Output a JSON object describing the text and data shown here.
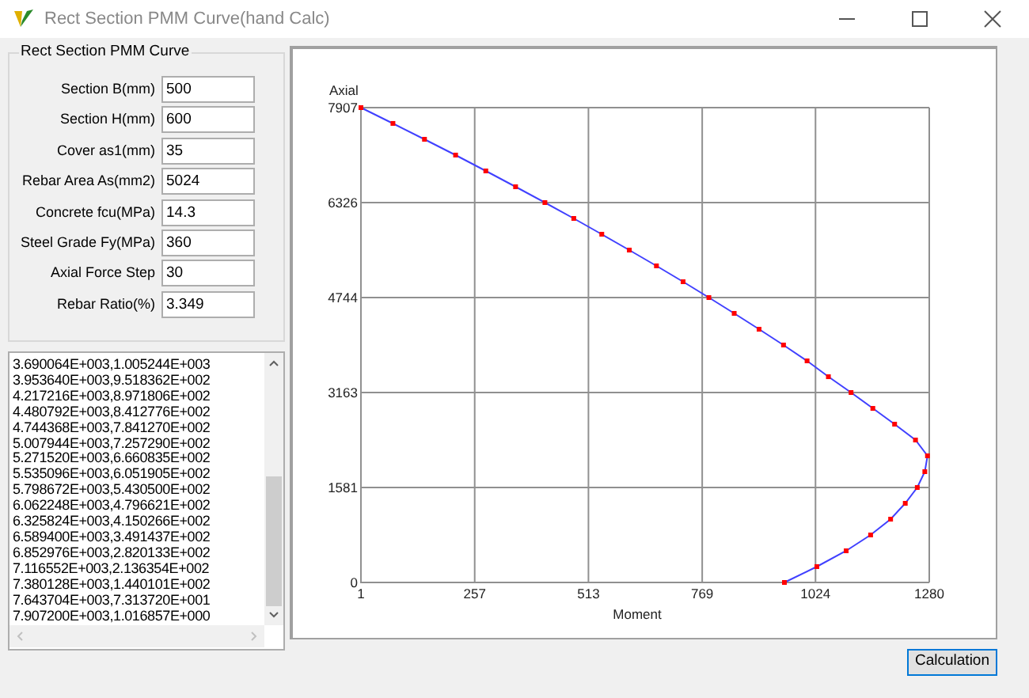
{
  "window": {
    "title": "Rect Section PMM Curve(hand Calc)"
  },
  "group": {
    "title": "Rect Section PMM Curve",
    "fields": [
      {
        "label": "Section B(mm)",
        "value": "500"
      },
      {
        "label": "Section H(mm)",
        "value": "600"
      },
      {
        "label": "Cover as1(mm)",
        "value": "35"
      },
      {
        "label": "Rebar Area As(mm2)",
        "value": "5024"
      },
      {
        "label": "Concrete fcu(MPa)",
        "value": "14.3"
      },
      {
        "label": "Steel Grade Fy(MPa)",
        "value": "360"
      },
      {
        "label": "Axial Force Step",
        "value": "30"
      },
      {
        "label": "Rebar Ratio(%)",
        "value": "3.349"
      }
    ]
  },
  "output_list": {
    "lines": [
      "3.690064E+003,1.005244E+003",
      "3.953640E+003,9.518362E+002",
      "4.217216E+003,8.971806E+002",
      "4.480792E+003,8.412776E+002",
      "4.744368E+003,7.841270E+002",
      "5.007944E+003,7.257290E+002",
      "5.271520E+003,6.660835E+002",
      "5.535096E+003,6.051905E+002",
      "5.798672E+003,5.430500E+002",
      "6.062248E+003,4.796621E+002",
      "6.325824E+003,4.150266E+002",
      "6.589400E+003,3.491437E+002",
      "6.852976E+003,2.820133E+002",
      "7.116552E+003,2.136354E+002",
      "7.380128E+003,1.440101E+002",
      "7.643704E+003,7.313720E+001",
      "7.907200E+003,1.016857E+000"
    ]
  },
  "chart": {
    "chart_data": {
      "type": "line",
      "xlabel": "Moment",
      "ylabel": "Axial",
      "x": [
        954,
        1027,
        1093,
        1148,
        1193,
        1226,
        1253,
        1270,
        1276,
        1249,
        1202,
        1153,
        1104,
        1053,
        1005,
        952,
        897,
        841,
        784,
        726,
        666,
        605,
        543,
        480,
        415,
        349,
        282,
        214,
        144,
        73,
        1
      ],
      "series": [
        {
          "color": "#4040ff",
          "marker": "square",
          "values": [
            0,
            264,
            527,
            791,
            1054,
            1318,
            1581,
            1845,
            2109,
            2372,
            2636,
            2899,
            3163,
            3426,
            3690,
            3954,
            4217,
            4481,
            4744,
            5008,
            5272,
            5535,
            5799,
            6062,
            6326,
            6589,
            6853,
            7117,
            7380,
            7644,
            7907
          ]
        }
      ],
      "grid": true,
      "xlim": [
        1,
        1280
      ],
      "ylim": [
        0,
        7907
      ],
      "xticks": [
        1,
        257,
        513,
        769,
        1024,
        1280
      ],
      "yticks": [
        0,
        1581,
        3163,
        4744,
        6326,
        7907
      ]
    }
  },
  "buttons": [
    {
      "label": "Calculation",
      "focused": true
    }
  ]
}
